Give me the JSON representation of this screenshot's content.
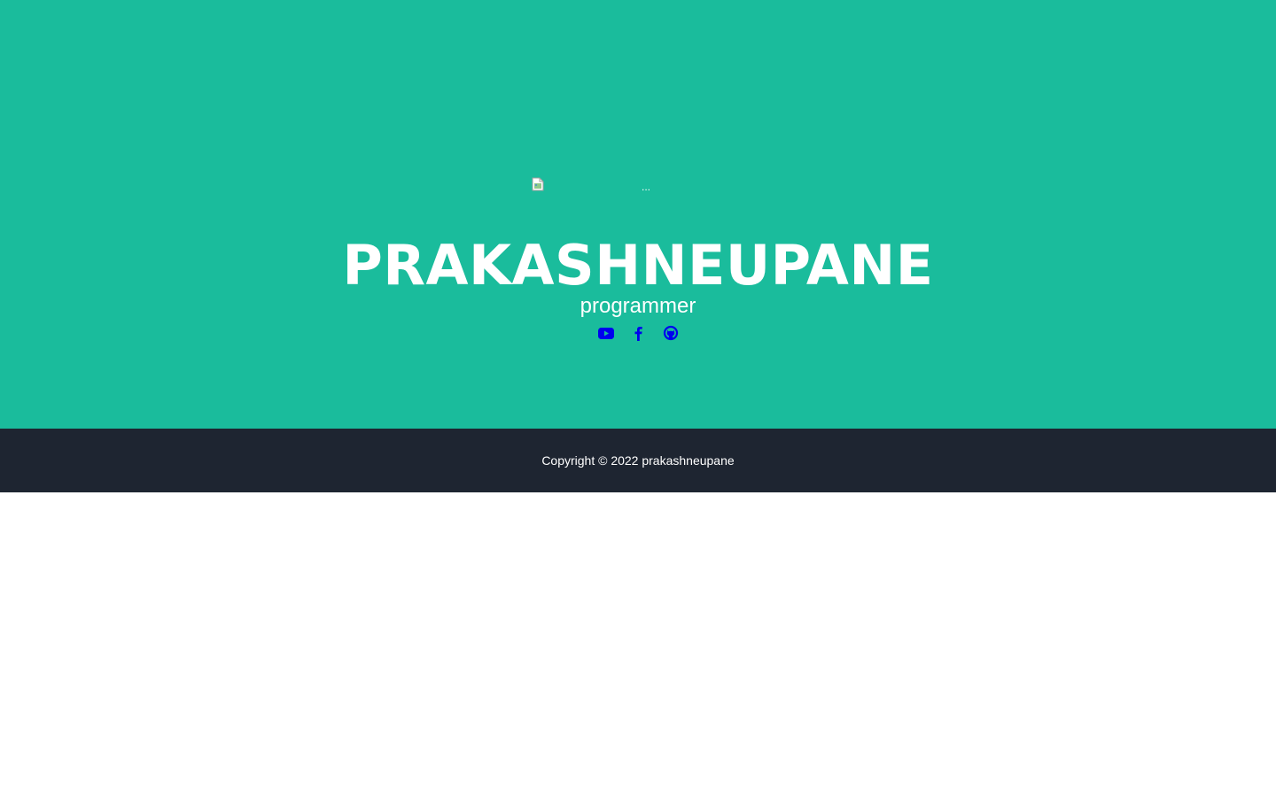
{
  "profile": {
    "image_alt": "...",
    "name": "PRAKASHNEUPANE",
    "role": "programmer"
  },
  "social": [
    {
      "icon": "youtube-icon"
    },
    {
      "icon": "facebook-icon"
    },
    {
      "icon": "github-icon"
    }
  ],
  "footer": {
    "copyright": "Copyright © 2022 prakashneupane"
  },
  "colors": {
    "hero_bg": "#1abc9c",
    "footer_bg": "#1e2531",
    "text": "#ffffff",
    "link": "#0000ee"
  }
}
